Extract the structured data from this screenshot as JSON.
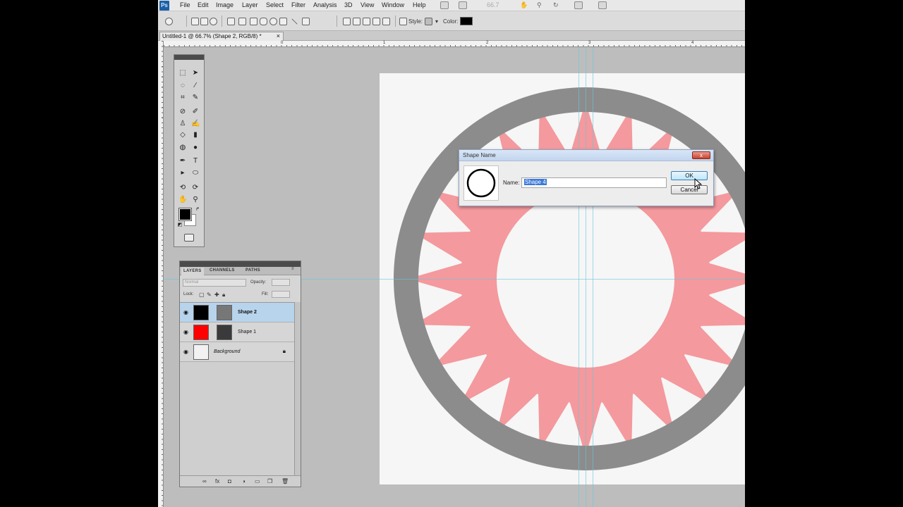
{
  "app": {
    "logo": "Ps"
  },
  "menu": {
    "items": [
      "File",
      "Edit",
      "Image",
      "Layer",
      "Select",
      "Filter",
      "Analysis",
      "3D",
      "View",
      "Window",
      "Help"
    ],
    "zoom_level": "66.7"
  },
  "options_bar": {
    "style_label": "Style:",
    "color_label": "Color:",
    "color_value": "#000000"
  },
  "document_tab": {
    "title": "Untitled-1 @ 66.7% (Shape 2, RGB/8) *",
    "close_glyph": "×"
  },
  "rulers": {
    "marks": [
      "0",
      "1",
      "2",
      "3",
      "4",
      "5",
      "6",
      "7"
    ]
  },
  "layers_panel": {
    "tabs": [
      "LAYERS",
      "CHANNELS",
      "PATHS"
    ],
    "blend_mode": "Normal",
    "opacity_label": "Opacity:",
    "lock_label": "Lock:",
    "fill_label": "Fill:",
    "layers": [
      {
        "name": "Shape 2",
        "selected": true,
        "color": "#000000"
      },
      {
        "name": "Shape 1",
        "selected": false,
        "color": "#ff0000"
      },
      {
        "name": "Background",
        "selected": false,
        "locked": true
      }
    ]
  },
  "dialog": {
    "title": "Shape Name",
    "name_label": "Name:",
    "name_value": "Shape 4",
    "ok_label": "OK",
    "cancel_label": "Cancel",
    "close_glyph": "x"
  },
  "colors": {
    "ring": "#8c8c8c",
    "sun": "#f4999d",
    "canvas": "#f6f6f6",
    "guides": "#64c8dc"
  }
}
